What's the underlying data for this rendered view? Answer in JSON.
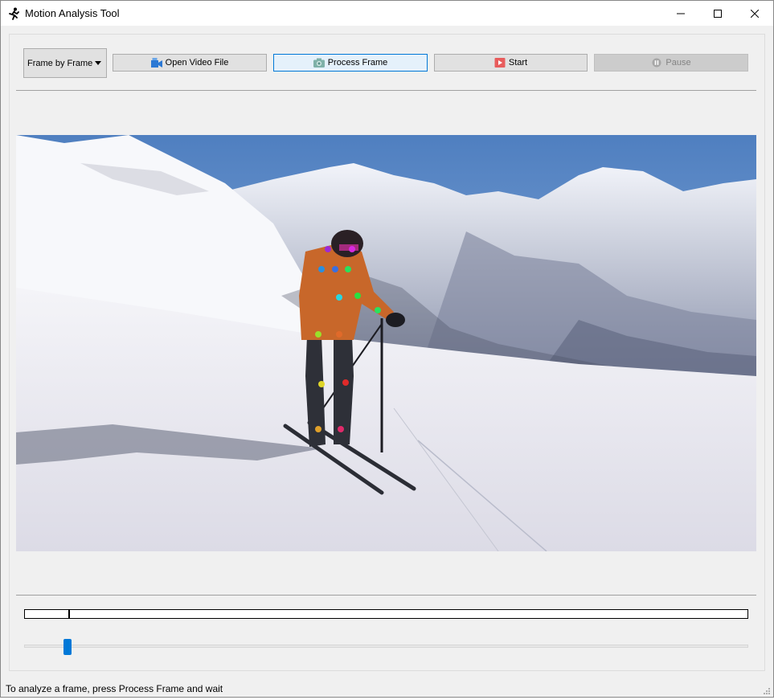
{
  "window": {
    "title": "Motion Analysis Tool"
  },
  "toolbar": {
    "mode_select": {
      "value": "Frame by Frame"
    },
    "open_label": "Open Video File",
    "process_label": "Process Frame",
    "start_label": "Start",
    "pause_label": "Pause",
    "pause_enabled": false
  },
  "playback": {
    "progress_fraction": 0.06,
    "slider_fraction": 0.06
  },
  "status": {
    "text": "To analyze a frame, press Process Frame and wait"
  },
  "colors": {
    "accent": "#0078d7",
    "window_bg": "#f0f0f0",
    "sky": "#5b86c2"
  },
  "icons": [
    "runner-icon",
    "minimize-icon",
    "maximize-icon",
    "close-icon",
    "video-file-icon",
    "camera-icon",
    "play-icon",
    "pause-icon",
    "resize-grip-icon"
  ]
}
